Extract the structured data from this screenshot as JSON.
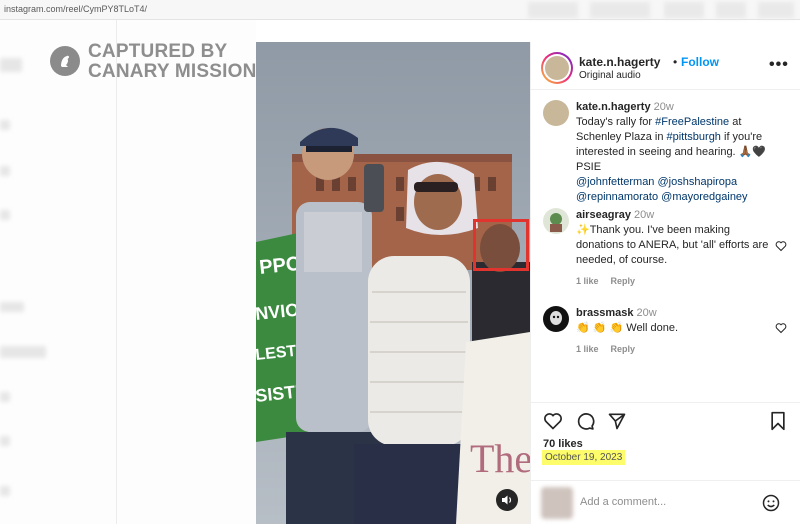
{
  "browser": {
    "url": "instagram.com/reel/CymPY8TLoT4/"
  },
  "watermark": {
    "line1": "CAPTURED BY",
    "line2": "CANARY MISSION"
  },
  "post": {
    "username": "kate.n.hagerty",
    "follow_label": "Follow",
    "audio": "Original audio",
    "more_icon": "more-horizontal-icon"
  },
  "caption": {
    "username": "kate.n.hagerty",
    "time": "20w",
    "text_before": "Today's rally for ",
    "hashtag1": "#FreePalestine",
    "text_mid": " at Schenley Plaza in ",
    "hashtag2": "#pittsburgh",
    "text_after": " if you're interested in seeing and hearing. 🙏🏾🖤PSIE",
    "mention1": "@johnfetterman",
    "mention2": "@joshshapiropa",
    "mention3": "@repinnamorato",
    "mention4": "@mayoredgainey"
  },
  "comments": [
    {
      "username": "airseagray",
      "time": "20w",
      "text": "✨Thank you. I've been making donations to ANERA, but 'all' efforts are needed, of course.",
      "likes": "1 like",
      "reply": "Reply"
    },
    {
      "username": "brassmask",
      "time": "20w",
      "text": "👏 👏 👏  Well done.",
      "likes": "1 like",
      "reply": "Reply"
    }
  ],
  "stats": {
    "likes": "70 likes",
    "date": "October 19, 2023"
  },
  "add_comment": {
    "placeholder": "Add a comment..."
  },
  "video_signs": {
    "left_sign": "PPORT\nNVIOLENT\nLESTINIAN\nSISTN"
  },
  "colors": {
    "link": "#00376b",
    "follow": "#0095f6",
    "highlight": "#fdfc6a",
    "red_box": "#e2342f"
  }
}
